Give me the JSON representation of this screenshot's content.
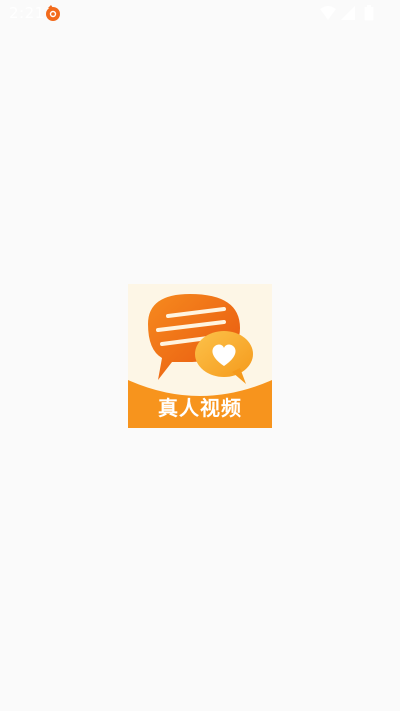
{
  "status_bar": {
    "time": "2:21",
    "icons": [
      "notification-app-icon",
      "wifi-icon",
      "signal-icon",
      "battery-icon"
    ]
  },
  "splash": {
    "logo_caption": "真人视频",
    "colors": {
      "background": "#fafafa",
      "logo_bg": "#fdf6e6",
      "accent_orange": "#f7941d",
      "bubble_orange": "#f47a1c",
      "bubble_yellow": "#fbb03b"
    }
  }
}
